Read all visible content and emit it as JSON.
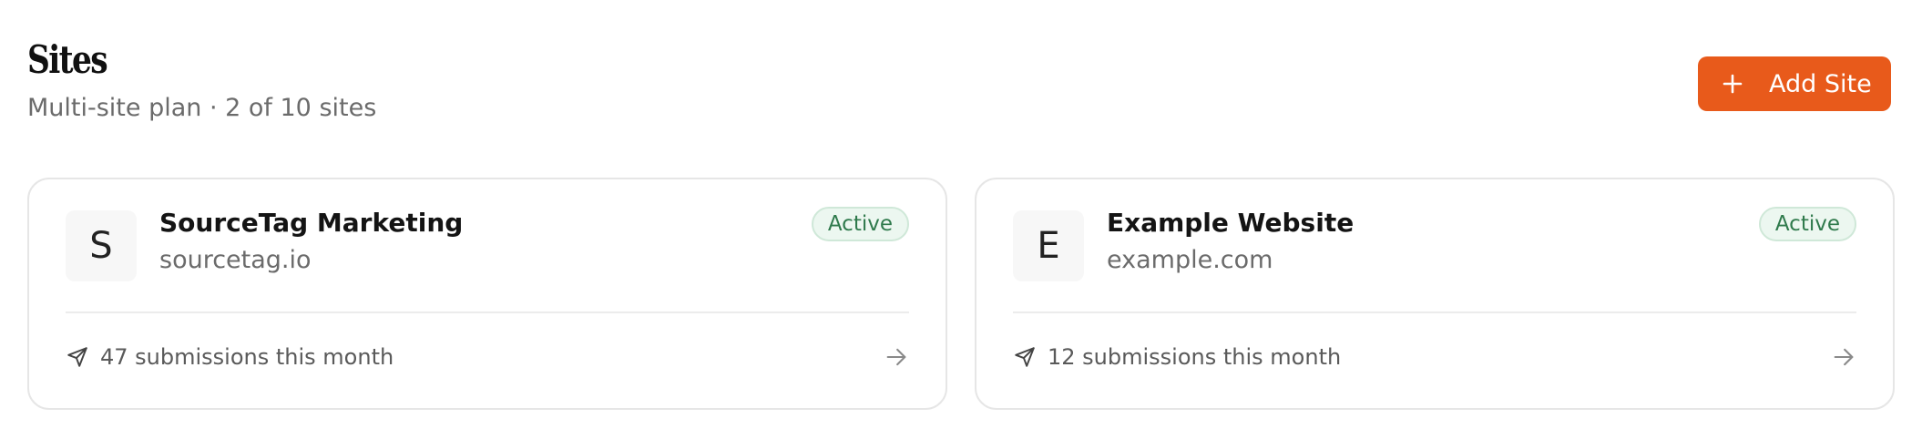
{
  "header": {
    "title": "Sites",
    "subtitle": "Multi-site plan · 2 of 10 sites"
  },
  "actions": {
    "add_site_label": "Add Site",
    "add_site_icon": "plus-icon"
  },
  "colors": {
    "accent": "#e85a1b",
    "active_badge_bg": "#ecf7f0",
    "active_badge_text": "#2f7a4c"
  },
  "sites": [
    {
      "initial": "S",
      "name": "SourceTag Marketing",
      "domain": "sourcetag.io",
      "status": "Active",
      "submissions": "47 submissions this month"
    },
    {
      "initial": "E",
      "name": "Example Website",
      "domain": "example.com",
      "status": "Active",
      "submissions": "12 submissions this month"
    }
  ]
}
